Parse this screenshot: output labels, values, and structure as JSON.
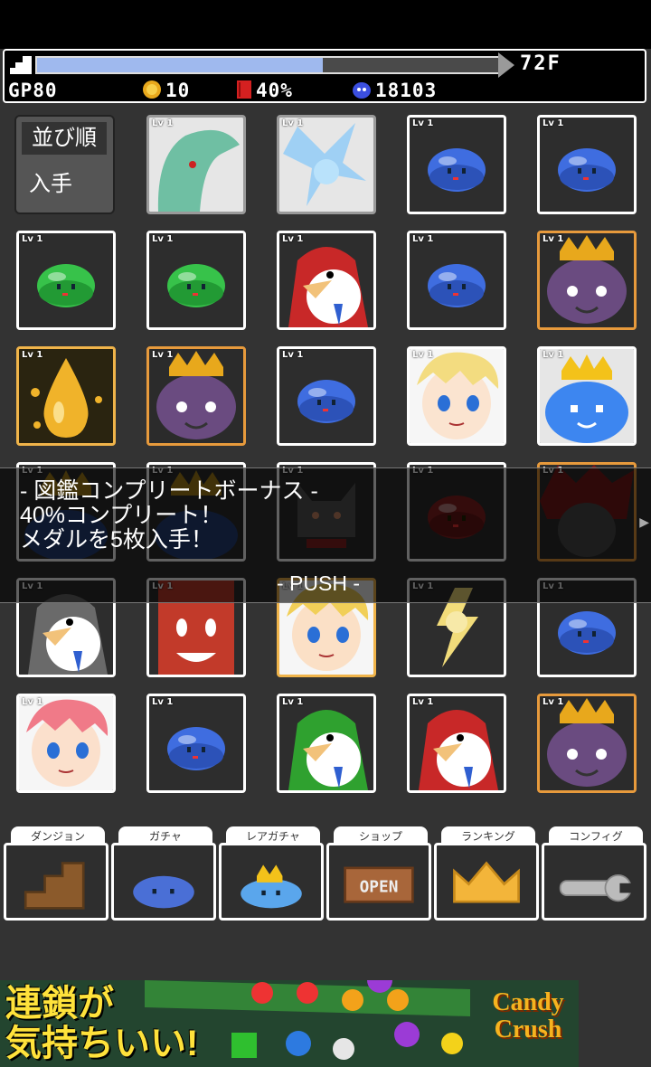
{
  "hud": {
    "floor": "72F",
    "progress": 0.62,
    "gp_label": "GP80",
    "coins": "10",
    "book_percent": "40%",
    "souls": "18103"
  },
  "sort": {
    "title": "並び順",
    "value": "入手"
  },
  "monsters": [
    {
      "lv": "Lv 1",
      "kind": "dragon",
      "border": "gray"
    },
    {
      "lv": "Lv 1",
      "kind": "ice-fairy",
      "border": "gray"
    },
    {
      "lv": "Lv 1",
      "kind": "blue-slime",
      "border": "white"
    },
    {
      "lv": "Lv 1",
      "kind": "blue-slime",
      "border": "white"
    },
    {
      "lv": "Lv 1",
      "kind": "green-slime",
      "border": "white"
    },
    {
      "lv": "Lv 1",
      "kind": "green-slime",
      "border": "white"
    },
    {
      "lv": "Lv 1",
      "kind": "red-penguin",
      "border": "white"
    },
    {
      "lv": "Lv 1",
      "kind": "blue-slime",
      "border": "white"
    },
    {
      "lv": "Lv 1",
      "kind": "purple-king",
      "border": "orange"
    },
    {
      "lv": "Lv 1",
      "kind": "gold-drop",
      "border": "gold"
    },
    {
      "lv": "Lv 1",
      "kind": "purple-king",
      "border": "orange"
    },
    {
      "lv": "Lv 1",
      "kind": "blue-slime",
      "border": "white"
    },
    {
      "lv": "Lv 1",
      "kind": "blonde-girl",
      "border": "white"
    },
    {
      "lv": "Lv 1",
      "kind": "king-slime",
      "border": "white"
    },
    {
      "lv": "Lv 1",
      "kind": "king-slime-dark",
      "border": "white"
    },
    {
      "lv": "Lv 1",
      "kind": "king-slime-dark",
      "border": "white"
    },
    {
      "lv": "Lv 1",
      "kind": "gray-cat",
      "border": "white"
    },
    {
      "lv": "Lv 1",
      "kind": "red-slime",
      "border": "white"
    },
    {
      "lv": "Lv 1",
      "kind": "red-hair",
      "border": "orange"
    },
    {
      "lv": "Lv 1",
      "kind": "gray-penguin",
      "border": "white"
    },
    {
      "lv": "Lv 1",
      "kind": "red-monster",
      "border": "white"
    },
    {
      "lv": "Lv 1",
      "kind": "blonde-boy",
      "border": "gold"
    },
    {
      "lv": "Lv 1",
      "kind": "lightning-man",
      "border": "white"
    },
    {
      "lv": "Lv 1",
      "kind": "blue-slime",
      "border": "white"
    },
    {
      "lv": "Lv 1",
      "kind": "pink-girl",
      "border": "white"
    },
    {
      "lv": "Lv 1",
      "kind": "blue-slime",
      "border": "white"
    },
    {
      "lv": "Lv 1",
      "kind": "green-penguin",
      "border": "white"
    },
    {
      "lv": "Lv 1",
      "kind": "red-penguin",
      "border": "white"
    },
    {
      "lv": "Lv 1",
      "kind": "purple-king",
      "border": "orange"
    }
  ],
  "overlay": {
    "line1": "- 図鑑コンプリートボーナス -",
    "line2": "40%コンプリート！",
    "line3": "メダルを5枚入手！",
    "push": "- PUSH -"
  },
  "menu": [
    {
      "label": "ダンジョン",
      "icon": "stairs-icon"
    },
    {
      "label": "ガチャ",
      "icon": "slime-icon"
    },
    {
      "label": "レアガチャ",
      "icon": "crowned-slime-icon"
    },
    {
      "label": "ショップ",
      "icon": "open-sign-icon"
    },
    {
      "label": "ランキング",
      "icon": "crown-icon"
    },
    {
      "label": "コンフィグ",
      "icon": "wrench-icon"
    }
  ],
  "ad": {
    "text_line1": "連鎖が",
    "text_line2": "気持ちいい!",
    "logo_line1": "Candy",
    "logo_line2": "Crush"
  }
}
